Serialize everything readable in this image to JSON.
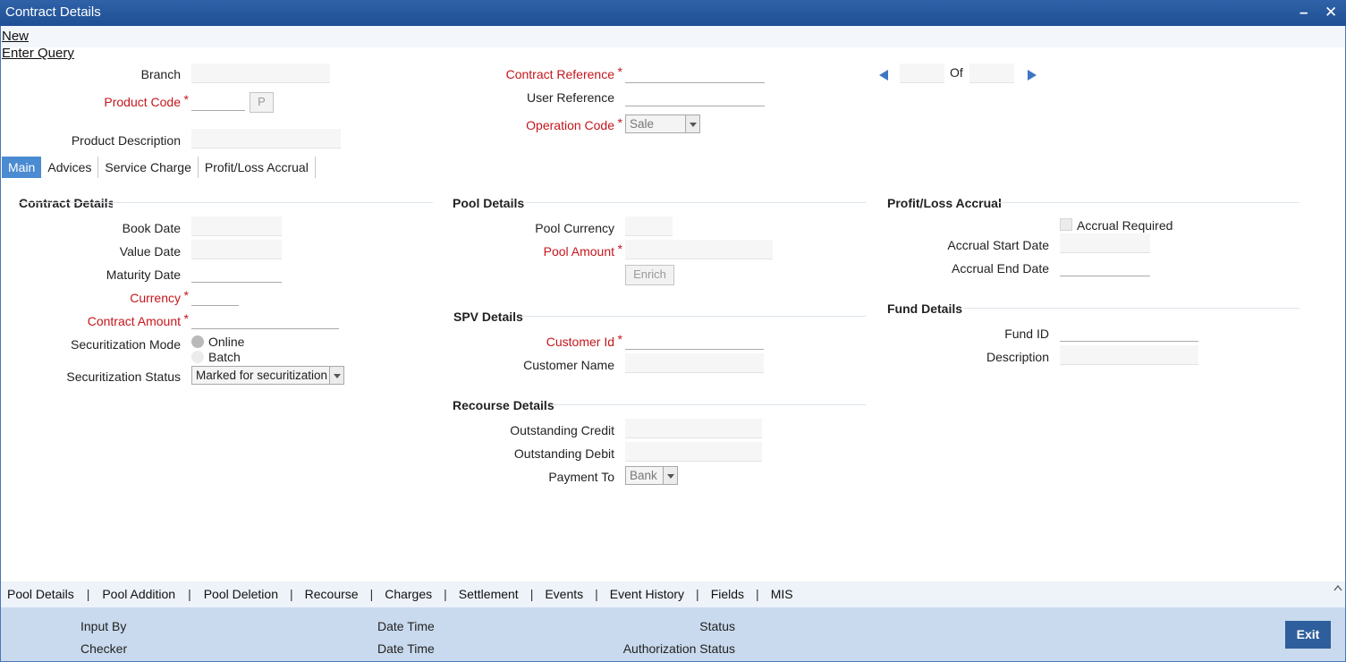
{
  "window": {
    "title": "Contract Details",
    "minimize": "–",
    "close": "✕"
  },
  "toolbar": {
    "new": "New",
    "enter_query": "Enter Query"
  },
  "header": {
    "branch": "Branch",
    "product_code": "Product Code",
    "product_button": "P",
    "product_description": "Product Description",
    "contract_reference": "Contract Reference",
    "user_reference": "User Reference",
    "operation_code": "Operation Code",
    "operation_code_value": "Sale",
    "of_label": "Of"
  },
  "tabs": [
    "Main",
    "Advices",
    "Service Charge",
    "Profit/Loss Accrual"
  ],
  "contract": {
    "title": "Contract Details",
    "book_date": "Book Date",
    "value_date": "Value Date",
    "maturity_date": "Maturity Date",
    "currency": "Currency",
    "contract_amount": "Contract Amount",
    "securitization_mode": "Securitization Mode",
    "mode_online": "Online",
    "mode_batch": "Batch",
    "securitization_status": "Securitization Status",
    "status_value": "Marked for securitization"
  },
  "pool": {
    "title": "Pool Details",
    "pool_currency": "Pool Currency",
    "pool_amount": "Pool Amount",
    "enrich": "Enrich"
  },
  "spv": {
    "title": "SPV Details",
    "customer_id": "Customer Id",
    "customer_name": "Customer Name"
  },
  "recourse": {
    "title": "Recourse Details",
    "outstanding_credit": "Outstanding Credit",
    "outstanding_debit": "Outstanding Debit",
    "payment_to": "Payment To",
    "payment_to_value": "Bank"
  },
  "accrual": {
    "title": "Profit/Loss Accrual",
    "accrual_required": "Accrual Required",
    "start_date": "Accrual Start Date",
    "end_date": "Accrual End Date"
  },
  "fund": {
    "title": "Fund Details",
    "fund_id": "Fund ID",
    "description": "Description"
  },
  "bottom_links": [
    "Pool Details",
    "Pool Addition",
    "Pool Deletion",
    "Recourse",
    "Charges",
    "Settlement",
    "Events",
    "Event History",
    "Fields",
    "MIS"
  ],
  "footer": {
    "input_by": "Input By",
    "checker": "Checker",
    "date_time_1": "Date Time",
    "date_time_2": "Date Time",
    "status": "Status",
    "authorization_status": "Authorization Status",
    "exit": "Exit"
  },
  "colors": {
    "titlebar": "#2a5ba0",
    "required": "#c4161c",
    "active_tab": "#4b8bd1",
    "footer": "#c9daee",
    "exit": "#2e5e9c"
  }
}
